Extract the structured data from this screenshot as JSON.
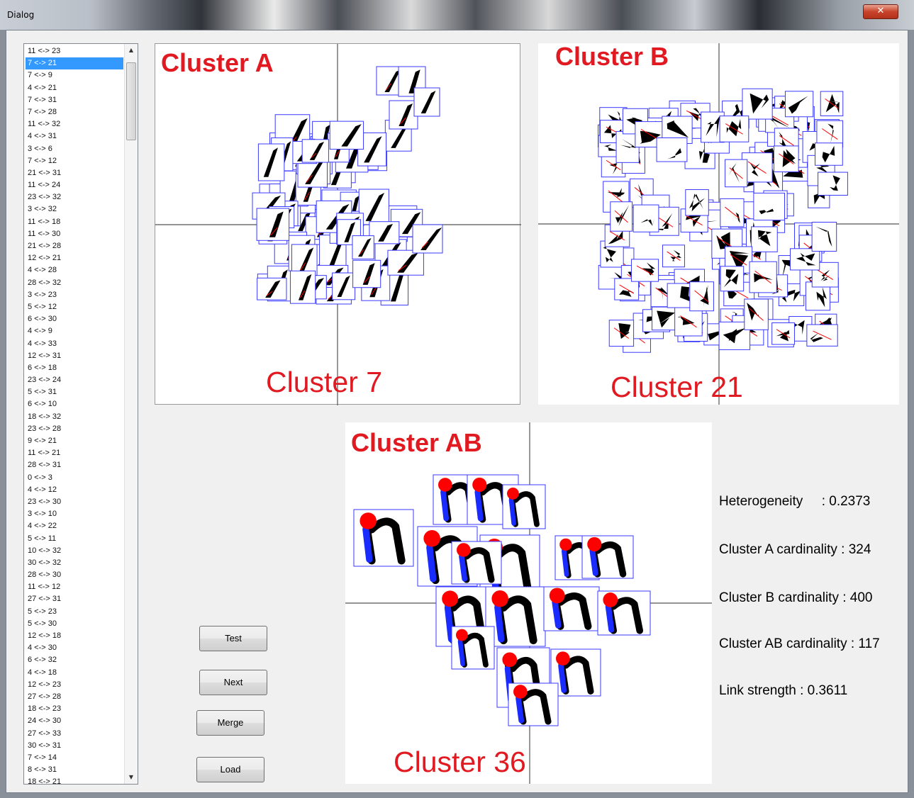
{
  "window": {
    "title": "Dialog",
    "close_glyph": "✕"
  },
  "list": {
    "selected_index": 1,
    "items": [
      "11 <-> 23",
      "7 <-> 21",
      "7 <-> 9",
      "4 <-> 21",
      "7 <-> 31",
      "7 <-> 28",
      "11 <-> 32",
      "4 <-> 31",
      "3 <-> 6",
      "7 <-> 12",
      "21 <-> 31",
      "11 <-> 24",
      "23 <-> 32",
      "3 <-> 32",
      "11 <-> 18",
      "11 <-> 30",
      "21 <-> 28",
      "12 <-> 21",
      "4 <-> 28",
      "28 <-> 32",
      "3 <-> 23",
      "5 <-> 12",
      "6 <-> 30",
      "4 <-> 9",
      "4 <-> 33",
      "12 <-> 31",
      "6 <-> 18",
      "23 <-> 24",
      "5 <-> 31",
      "6 <-> 10",
      "18 <-> 32",
      "23 <-> 28",
      "9 <-> 21",
      "11 <-> 21",
      "28 <-> 31",
      "0 <-> 3",
      "4 <-> 12",
      "23 <-> 30",
      "3 <-> 10",
      "4 <-> 22",
      "5 <-> 11",
      "10 <-> 32",
      "30 <-> 32",
      "28 <-> 30",
      "11 <-> 12",
      "27 <-> 31",
      "5 <-> 23",
      "5 <-> 30",
      "12 <-> 18",
      "4 <-> 30",
      "6 <-> 32",
      "4 <-> 18",
      "12 <-> 23",
      "27 <-> 28",
      "18 <-> 23",
      "24 <-> 30",
      "27 <-> 33",
      "30 <-> 31",
      "7 <-> 14",
      "8 <-> 31",
      "18 <-> 21"
    ]
  },
  "panels": {
    "a": {
      "title": "Cluster A",
      "subtitle": "Cluster 7"
    },
    "b": {
      "title": "Cluster B",
      "subtitle": "Cluster 21"
    },
    "ab": {
      "title": "Cluster AB",
      "subtitle": "Cluster 36"
    }
  },
  "buttons": {
    "test": "Test",
    "next": "Next",
    "merge": "Merge",
    "load": "Load"
  },
  "stats": {
    "heterogeneity": "Heterogeneity     : 0.2373",
    "cluster_a_cardinality": "Cluster A cardinality : 324",
    "cluster_b_cardinality": "Cluster B cardinality : 400",
    "cluster_ab_cardinality": "Cluster AB cardinality : 117",
    "link_strength": "Link strength : 0.3611"
  },
  "colors": {
    "accent_text": "#e11a22",
    "box_border": "#3a3aff",
    "selection": "#3399ff",
    "stroke_red": "#ff0000",
    "stroke_blue": "#1a2bff"
  }
}
